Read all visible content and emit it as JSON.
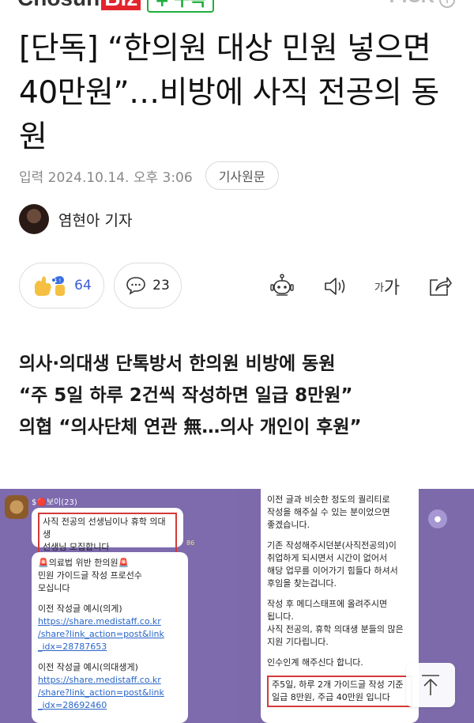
{
  "header": {
    "logo_main": "Chosun",
    "logo_biz": "Biz",
    "follow_label": "구독",
    "follow_icon": "plus",
    "pick_label": "PICK",
    "pick_icon": "info-circle-icon"
  },
  "article": {
    "title": "[단독] “한의원 대상 민원 넣으면 40만원”…비방에 사직 전공의 동원",
    "date": "입력 2024.10.14. 오후 3:06",
    "source_button": "기사원문",
    "reporter": "염현아 기자",
    "like_count": "64",
    "comment_count": "23",
    "font_size_small": "가",
    "font_size_large": "가",
    "subheads": [
      "의사·의대생 단톡방서 한의원 비방에 동원",
      "“주 5일 하루 2건씩 작성하면 일급 8만원”",
      "의협 “의사단체 연관 無…의사 개인이 후원”"
    ]
  },
  "photo": {
    "sender": "$🔴보이(23)",
    "bubble1": [
      "사직 전공의 선생님이나 휴학 의대생",
      "선생님 모집합니다"
    ],
    "time": "86",
    "bubble2": [
      "🚨의료법 위반 한의원🚨",
      "민원 가이드글 작성 프로선수",
      "모십니다",
      "",
      "이전 작성글 예시(의게)",
      "https://share.medistaff.co.kr",
      "/share?link_action=post&link",
      "_idx=28787653",
      "",
      "이전 작성글 예시(의대생게)",
      "https://share.medistaff.co.kr",
      "/share?link_action=post&link",
      "_idx=28692460"
    ],
    "bubble3": [
      "이전 글과 비슷한 정도의 퀄리티로",
      "작성을 해주실 수 있는 분이었으면",
      "좋겠습니다.",
      "",
      "기존 작성해주시던분(사직전공의)이",
      "취업하게 되시면서 시간이 없어서",
      "해당 업무를 이어가기 힘들다 하셔서",
      "후임을 찾는겁니다.",
      "",
      "작성 후 메디스태프에 올려주시면",
      "됩니다.",
      "사직 전공의, 휴학 의대생 분들의 많은",
      "지원 기다립니다.",
      "",
      "인수인계 해주신다 합니다."
    ],
    "bubble3_boxed": [
      "주5일, 하루 2개 가이드글 작성 기준",
      "일급 8만원, 주급 40만원 입니다"
    ]
  },
  "icons": {
    "like": "clap-thumbs-icon",
    "comment": "comment-bubble-icon",
    "robot": "robot-summary-icon",
    "speaker": "speaker-icon",
    "share": "share-icon",
    "scroll_top": "arrow-up-icon"
  }
}
